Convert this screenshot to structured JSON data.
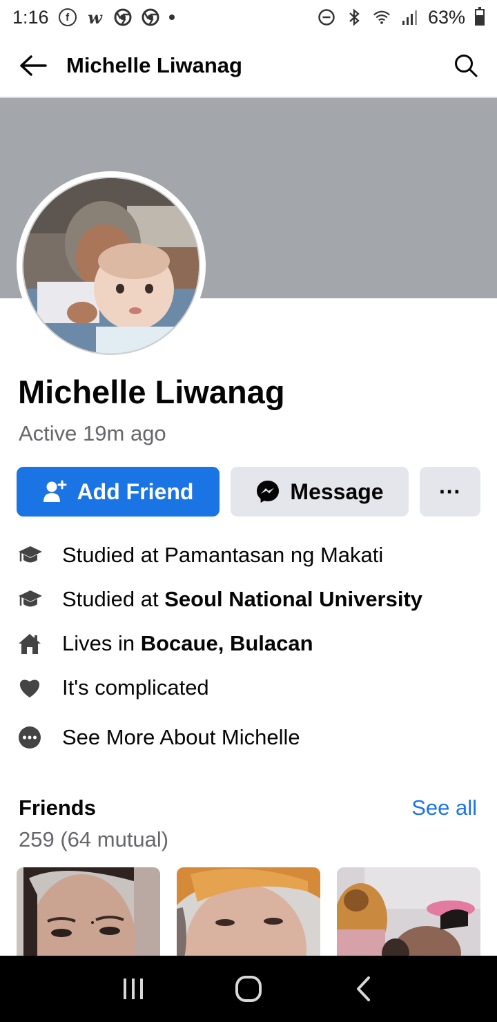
{
  "status_bar": {
    "time": "1:16",
    "battery": "63%",
    "battery_level": 0.63,
    "notification_icons": [
      "facebook-icon",
      "webnovel-icon",
      "chrome-icon",
      "chrome-icon",
      "more-dot-icon"
    ],
    "system_icons": [
      "do-not-disturb-icon",
      "bluetooth-icon",
      "wifi-icon",
      "signal-icon",
      "battery-icon"
    ]
  },
  "header": {
    "title": "Michelle Liwanag",
    "back_icon": "arrow-left-icon",
    "search_icon": "search-icon"
  },
  "profile": {
    "name": "Michelle Liwanag",
    "active_status": "Active 19m ago",
    "cover_color": "#a3a6ab"
  },
  "actions": {
    "add_friend": "Add Friend",
    "message": "Message",
    "more": "···"
  },
  "intro": {
    "items": [
      {
        "icon": "graduation-cap-icon",
        "prefix": "Studied at Pamantasan ng Makati",
        "bold": ""
      },
      {
        "icon": "graduation-cap-icon",
        "prefix": "Studied at ",
        "bold": "Seoul National University"
      },
      {
        "icon": "home-icon",
        "prefix": "Lives in ",
        "bold": "Bocaue, Bulacan"
      },
      {
        "icon": "heart-icon",
        "prefix": "It's complicated",
        "bold": ""
      }
    ],
    "see_more": "See More About Michelle"
  },
  "friends": {
    "title": "Friends",
    "see_all": "See all",
    "count": "259 (64 mutual)"
  },
  "colors": {
    "accent": "#1b74e4",
    "secondary_text": "#65676b",
    "button_gray": "#e4e6eb"
  },
  "nav_bar": {
    "icons": [
      "recent-apps-icon",
      "home-circle-icon",
      "back-chevron-icon"
    ]
  }
}
